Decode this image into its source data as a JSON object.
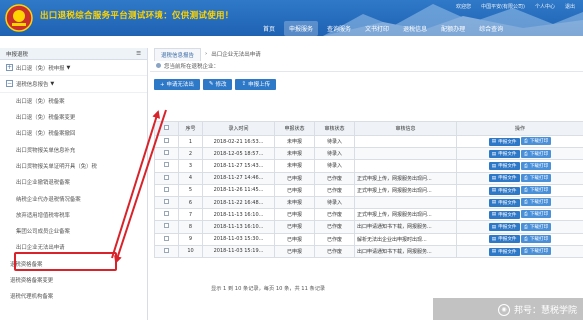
{
  "header": {
    "title": "出口退税综合服务平台测试环境：仅供测试使用！",
    "links": [
      "欢迎您",
      "中国平安(有限公司)",
      "个人中心",
      "退出"
    ],
    "nav": [
      "首页",
      "申报服务",
      "查询服务",
      "文书打印",
      "退税信息",
      "配额办理",
      "综合查询"
    ]
  },
  "sidebar": {
    "title": "申报退税",
    "toggle_icon": "menu-icon",
    "groups": [
      {
        "label": "出口退（免）税申报",
        "expanded": false
      },
      {
        "label": "退税信息报告",
        "expanded": true
      }
    ],
    "items": [
      "出口退（免）税备案",
      "出口退（免）税备案变更",
      "出口退（免）税备案撤回",
      "出口货物报关单信息补充",
      "出口货物报关单证明开具（免）税",
      "出口企业撤销退税备案",
      "纳税企业代办退税情况备案",
      "放弃适用增值税零税率",
      "集团公司成员企业备案",
      "出口企业无法出申请",
      "退税资格备案",
      "退税资格备案变更",
      "退税代理机构备案"
    ],
    "selected_index": 9
  },
  "main": {
    "breadcrumb": [
      "退税信息报告",
      "出口企业无法出申请"
    ],
    "notice": "您当前所在退税企业：",
    "toolbar": [
      {
        "label": "+ 申请无法出",
        "icon": "plus-icon"
      },
      {
        "label": "修改",
        "icon": "edit-icon"
      },
      {
        "label": "申报上传",
        "icon": "upload-icon"
      }
    ],
    "table": {
      "headers": [
        "",
        "序号",
        "录入时间",
        "申报状态",
        "审核状态",
        "审核信息",
        "操作"
      ],
      "rows": [
        {
          "seq": "1",
          "time": "2018-02-21 16:53...",
          "declare": "未申报",
          "audit": "待录入",
          "info": ""
        },
        {
          "seq": "2",
          "time": "2018-12-05 18:57...",
          "declare": "未申报",
          "audit": "待录入",
          "info": ""
        },
        {
          "seq": "3",
          "time": "2018-11-27 15:43...",
          "declare": "未申报",
          "audit": "待录入",
          "info": ""
        },
        {
          "seq": "4",
          "time": "2018-11-27 14:46...",
          "declare": "已申报",
          "audit": "已作废",
          "info": "正式申报上传，网报服务出现问..."
        },
        {
          "seq": "5",
          "time": "2018-11-26 11:45...",
          "declare": "已申报",
          "audit": "已作废",
          "info": "正式申报上传，网报服务出现问..."
        },
        {
          "seq": "6",
          "time": "2018-11-22 16:48...",
          "declare": "未申报",
          "audit": "待录入",
          "info": ""
        },
        {
          "seq": "7",
          "time": "2018-11-13 16:10...",
          "declare": "已申报",
          "audit": "已作废",
          "info": "正式申报上传，网报服务出现问..."
        },
        {
          "seq": "8",
          "time": "2018-11-13 16:10...",
          "declare": "已申报",
          "audit": "已作废",
          "info": "出口申请通知书下载，网报服务..."
        },
        {
          "seq": "9",
          "time": "2018-11-03 15:30...",
          "declare": "已申报",
          "audit": "已作废",
          "info": "解析无法出企业出申报时出现..."
        },
        {
          "seq": "10",
          "time": "2018-11-03 15:19...",
          "declare": "已申报",
          "audit": "已作废",
          "info": "出口申请通知书下载，网报服务..."
        }
      ],
      "actions": [
        {
          "label": "申报文件",
          "icon": "document-icon"
        },
        {
          "label": "下载打印",
          "icon": "print-icon"
        }
      ]
    },
    "pager": "显示 1 到 10 条记录，每页 10 条，共 11 条记录"
  },
  "watermark": {
    "text": "邦号：慧税学院"
  },
  "colors": {
    "header": "#1f62b3",
    "title": "#ffd400",
    "primary": "#2e78c8",
    "annotation": "#d8232a"
  }
}
